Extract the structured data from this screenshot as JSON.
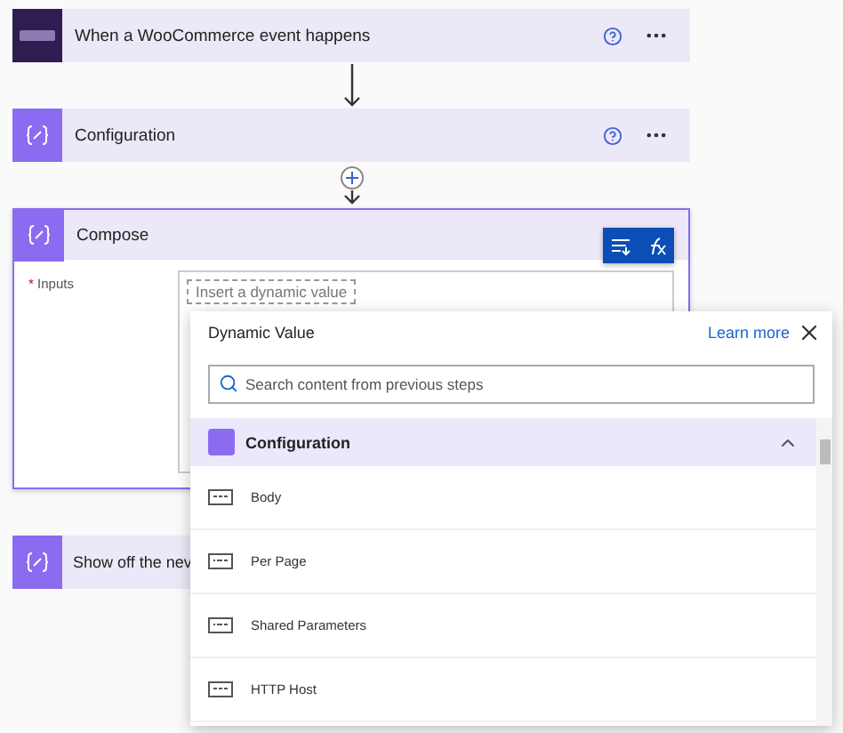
{
  "steps": [
    {
      "title": "When a WooCommerce event happens",
      "kind": "trigger"
    },
    {
      "title": "Configuration",
      "kind": "action"
    }
  ],
  "compose": {
    "title": "Compose",
    "field": {
      "label": "Inputs",
      "required_mark": "*",
      "placeholder": "Insert a dynamic value"
    }
  },
  "next_step": {
    "title": "Show off the nev"
  },
  "dynamic_panel": {
    "title": "Dynamic Value",
    "link": "Learn more",
    "search": {
      "placeholder": "Search content from previous steps"
    },
    "section": {
      "title": "Configuration",
      "expanded": true,
      "items": [
        {
          "label": "Body",
          "kind": "string"
        },
        {
          "label": "Per Page",
          "kind": "number"
        },
        {
          "label": "Shared Parameters",
          "kind": "number"
        },
        {
          "label": "HTTP Host",
          "kind": "string"
        }
      ]
    }
  }
}
